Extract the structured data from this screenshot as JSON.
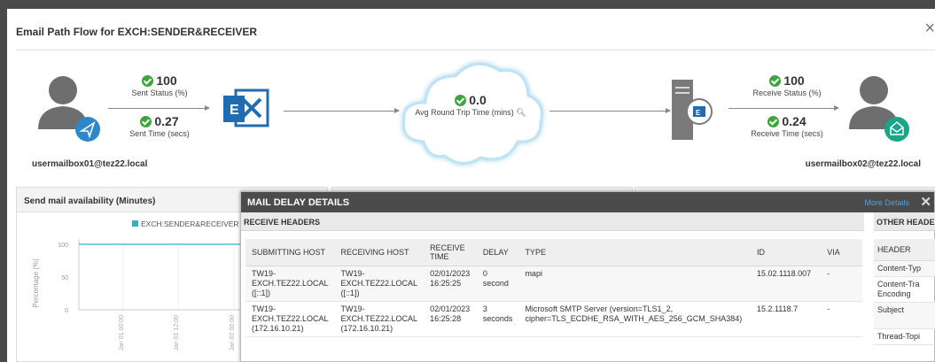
{
  "dialog": {
    "title": "Email Path Flow for EXCH:SENDER&RECEIVER",
    "close": "×"
  },
  "flow": {
    "sent_status": {
      "value": "100",
      "label": "Sent Status (%)"
    },
    "sent_time": {
      "value": "0.27",
      "label": "Sent Time (secs)"
    },
    "round_trip": {
      "value": "0.0",
      "label": "Avg Round Trip Time (mins)"
    },
    "receive_status": {
      "value": "100",
      "label": "Receive Status (%)"
    },
    "receive_time": {
      "value": "0.24",
      "label": "Receive Time (secs)"
    },
    "sender": "usermailbox01@tez22.local",
    "receiver": "usermailbox02@tez22.local"
  },
  "panel_left": {
    "title": "Send mail availability (Minutes)",
    "legend": "EXCH:SENDER&RECEIVER",
    "y_label": "Percentage (%)",
    "y_ticks": [
      "100",
      "50",
      "0"
    ],
    "x_ticks": [
      "Jan 01 00:00",
      "Jan 01 12:00",
      "Jan 02 00:00"
    ]
  },
  "chart_data": {
    "type": "line",
    "title": "Send mail availability (Minutes)",
    "ylabel": "Percentage (%)",
    "ylim": [
      0,
      100
    ],
    "categories": [
      "Jan 01 00:00",
      "Jan 01 12:00",
      "Jan 02 00:00"
    ],
    "series": [
      {
        "name": "EXCH:SENDER&RECEIVER",
        "values": [
          100,
          100,
          100
        ]
      }
    ],
    "grid": true,
    "legend": "top"
  },
  "modal": {
    "title": "MAIL DELAY DETAILS",
    "more_details": "More Details",
    "close": "✕",
    "receive_headers": "RECEIVE HEADERS",
    "other_headers": "OTHER HEADE",
    "columns": [
      "SUBMITTING HOST",
      "RECEIVING HOST",
      "RECEIVE TIME",
      "DELAY",
      "TYPE",
      "ID",
      "VIA"
    ],
    "rows": [
      {
        "submitting": [
          "TW19-",
          "EXCH.TEZ22.LOCAL",
          "([::1])"
        ],
        "receiving": [
          "TW19-",
          "EXCH.TEZ22.LOCAL",
          "([::1])"
        ],
        "time": [
          "02/01/2023",
          "16:25:25"
        ],
        "delay": [
          "0",
          "second"
        ],
        "type": [
          "mapi"
        ],
        "id": "15.02.1118.007",
        "via": "-"
      },
      {
        "submitting": [
          "TW19-",
          "EXCH.TEZ22.LOCAL",
          "(172.16.10.21)"
        ],
        "receiving": [
          "TW19-",
          "EXCH.TEZ22.LOCAL",
          "(172.16.10.21)"
        ],
        "time": [
          "02/01/2023",
          "16:25:28"
        ],
        "delay": [
          "3",
          "seconds"
        ],
        "type": [
          "Microsoft SMTP Server (version=TLS1_2,",
          "cipher=TLS_ECDHE_RSA_WITH_AES_256_GCM_SHA384)"
        ],
        "id": "15.2.1118.7",
        "via": "-"
      }
    ],
    "other_columns": [
      "HEADER"
    ],
    "other_rows": [
      "Content-Typ",
      "Content-Tra Encoding",
      "Subject",
      "Thread-Topi"
    ]
  }
}
